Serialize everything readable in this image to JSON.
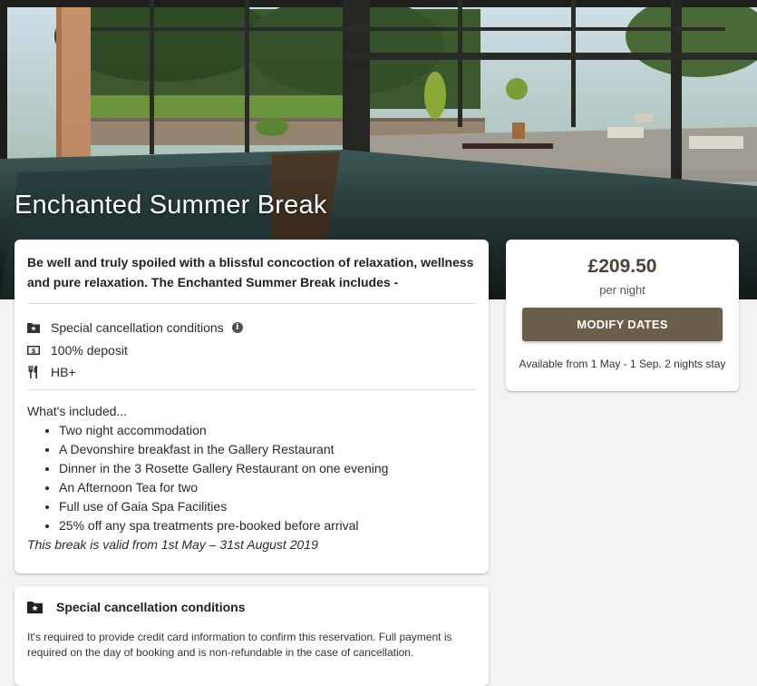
{
  "hero": {
    "title": "Enchanted Summer Break"
  },
  "offer": {
    "intro": "Be well and truly spoiled with a blissful concoction of relaxation, wellness and pure relaxation. The Enchanted Summer Break includes -",
    "features": [
      {
        "icon": "folder-star-icon",
        "label": "Special cancellation conditions",
        "has_info": true
      },
      {
        "icon": "banknote-icon",
        "label": "100% deposit",
        "has_info": false
      },
      {
        "icon": "restaurant-icon",
        "label": "HB+",
        "has_info": false
      }
    ],
    "included_title": "What's included...",
    "included_items": [
      "Two night accommodation",
      "A Devonshire breakfast in the Gallery Restaurant",
      "Dinner in the 3 Rosette Gallery Restaurant on one evening",
      "An Afternoon Tea for two",
      "Full use of Gaia Spa Facilities",
      "25% off any spa treatments pre-booked before arrival"
    ],
    "valid_note": "This break is valid from 1st May – 31st August 2019"
  },
  "pricing": {
    "price": "£209.50",
    "unit": "per night",
    "button_label": "MODIFY DATES",
    "availability": "Available from 1 May - 1 Sep. 2 nights stay"
  },
  "cancellation": {
    "title": "Special cancellation conditions",
    "text": "It's required to provide credit card information to confirm this reservation. Full payment is required on the day of booking and is non-refundable in the case of cancellation."
  },
  "colors": {
    "accent": "#6b5e4a",
    "price": "#4a4232"
  }
}
